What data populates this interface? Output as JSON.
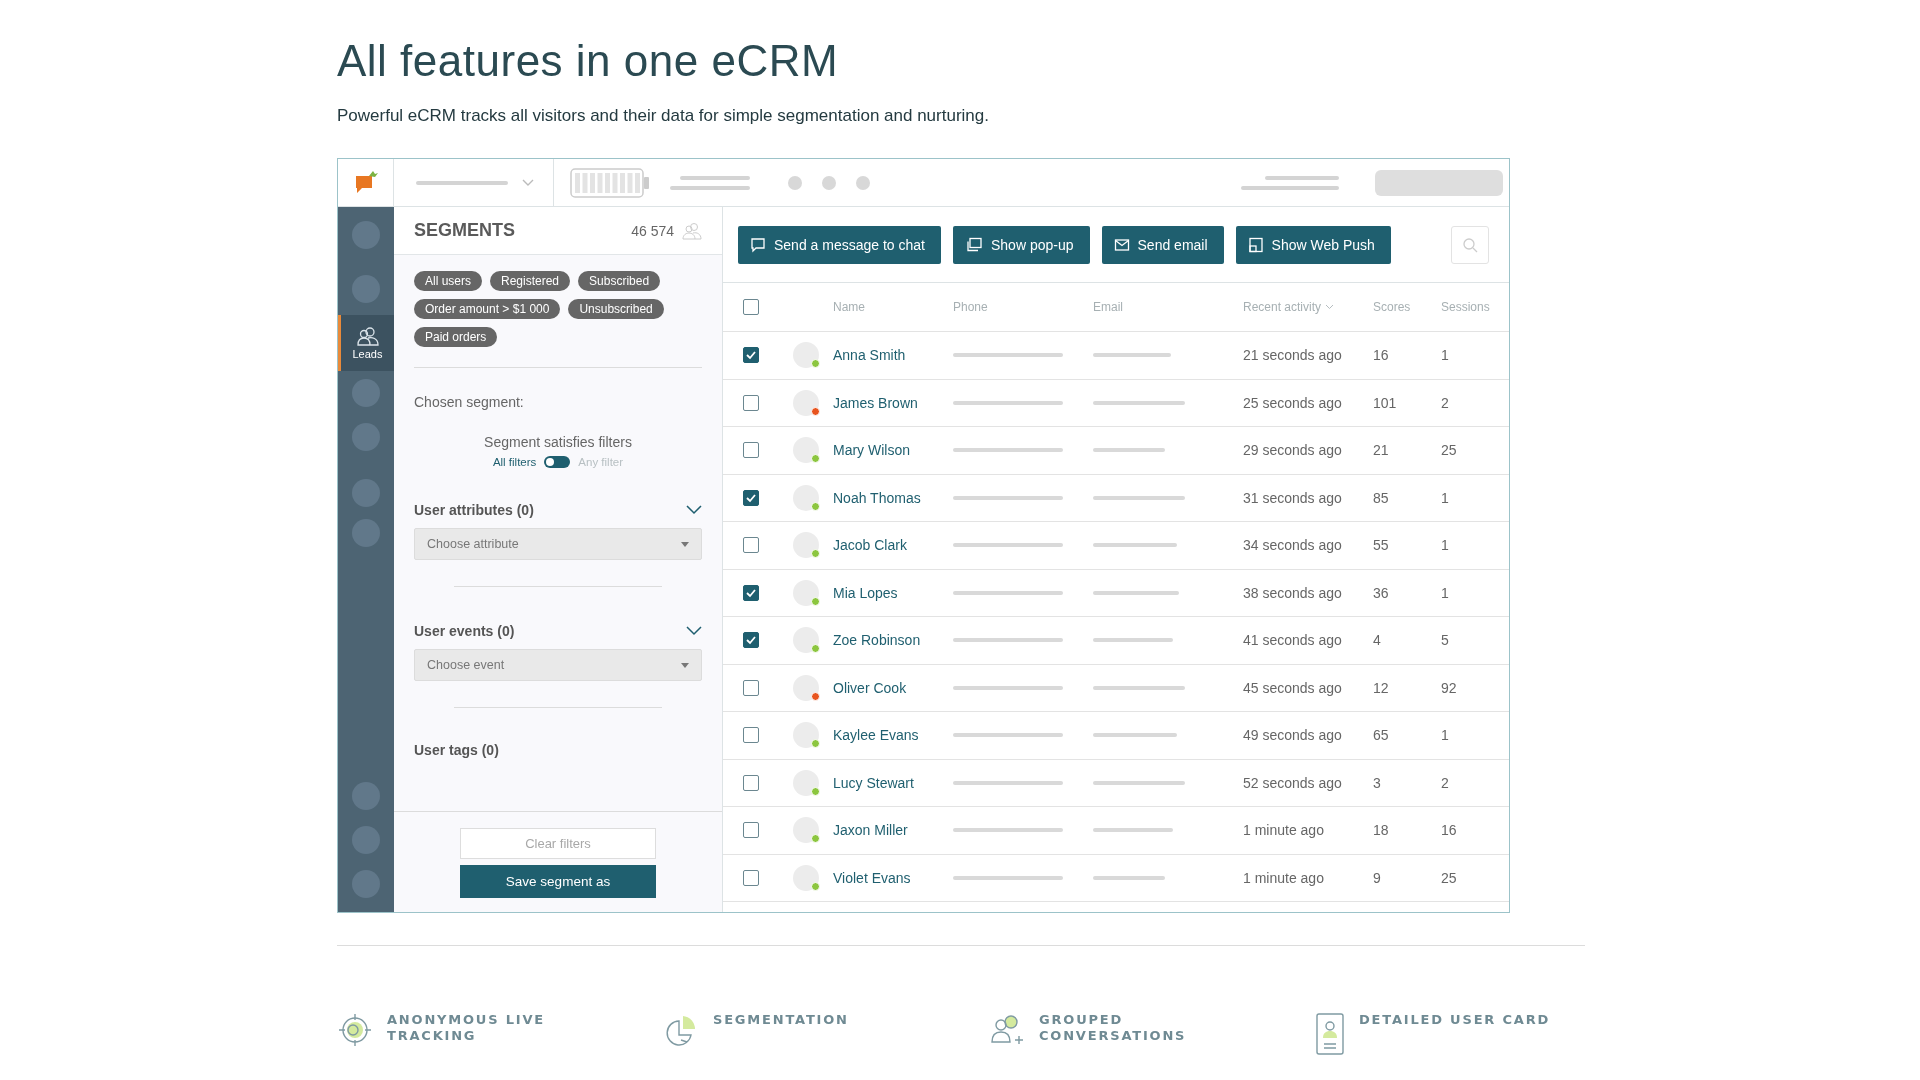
{
  "heading": "All features in one eCRM",
  "subheading": "Powerful eCRM tracks all visitors and their data for simple segmentation and nurturing.",
  "rail": [
    {
      "label": "Leads",
      "selected": true
    }
  ],
  "segments": {
    "title": "SEGMENTS",
    "count": "46 574",
    "chips": [
      "All users",
      "Registered",
      "Subscribed",
      "Order amount > $1 000",
      "Unsubscribed",
      "Paid orders"
    ],
    "chosen_label": "Chosen segment:",
    "filters_title": "Segment satisfies filters",
    "toggle": {
      "left": "All filters",
      "right": "Any filter",
      "on": false
    },
    "sections": [
      {
        "title": "User attributes (0)",
        "placeholder": "Choose attribute"
      },
      {
        "title": "User events (0)",
        "placeholder": "Choose event"
      },
      {
        "title": "User tags (0)"
      }
    ],
    "clear_button": "Clear filters",
    "save_button": "Save segment as"
  },
  "actions": [
    {
      "label": "Send a message to chat",
      "kind": "chat"
    },
    {
      "label": "Show pop-up",
      "kind": "popup"
    },
    {
      "label": "Send email",
      "kind": "mail"
    },
    {
      "label": "Show Web Push",
      "kind": "push"
    }
  ],
  "table": {
    "header_checked": false,
    "columns": [
      "Name",
      "Phone",
      "Email",
      "Recent activity",
      "Scores",
      "Sessions"
    ],
    "rows": [
      {
        "checked": true,
        "name": "Anna Smith",
        "activity": "21 seconds ago",
        "scores": "16",
        "sessions": "1",
        "color": "#8cc63f"
      },
      {
        "checked": false,
        "name": "James Brown",
        "activity": "25 seconds ago",
        "scores": "101",
        "sessions": "2",
        "color": "#e8541e"
      },
      {
        "checked": false,
        "name": "Mary Wilson",
        "activity": "29 seconds ago",
        "scores": "21",
        "sessions": "25",
        "color": "#8cc63f"
      },
      {
        "checked": true,
        "name": "Noah Thomas",
        "activity": "31 seconds ago",
        "scores": "85",
        "sessions": "1",
        "color": "#8cc63f"
      },
      {
        "checked": false,
        "name": "Jacob Clark",
        "activity": "34 seconds ago",
        "scores": "55",
        "sessions": "1",
        "color": "#8cc63f"
      },
      {
        "checked": true,
        "name": "Mia Lopes",
        "activity": "38 seconds ago",
        "scores": "36",
        "sessions": "1",
        "color": "#8cc63f"
      },
      {
        "checked": true,
        "name": "Zoe Robinson",
        "activity": "41 seconds ago",
        "scores": "4",
        "sessions": "5",
        "color": "#8cc63f"
      },
      {
        "checked": false,
        "name": "Oliver Cook",
        "activity": "45 seconds ago",
        "scores": "12",
        "sessions": "92",
        "color": "#e8541e"
      },
      {
        "checked": false,
        "name": "Kaylee Evans",
        "activity": "49 seconds ago",
        "scores": "65",
        "sessions": "1",
        "color": "#8cc63f"
      },
      {
        "checked": false,
        "name": "Lucy Stewart",
        "activity": "52 seconds ago",
        "scores": "3",
        "sessions": "2",
        "color": "#8cc63f"
      },
      {
        "checked": false,
        "name": "Jaxon Miller",
        "activity": "1 minute ago",
        "scores": "18",
        "sessions": "16",
        "color": "#8cc63f"
      },
      {
        "checked": false,
        "name": "Violet Evans",
        "activity": "1 minute ago",
        "scores": "9",
        "sessions": "25",
        "color": "#8cc63f"
      }
    ]
  },
  "features": [
    {
      "kind": "target",
      "label": "ANONYMOUS LIVE TRACKING"
    },
    {
      "kind": "pie",
      "label": "SEGMENTATION"
    },
    {
      "kind": "people",
      "label": "GROUPED CONVERSATIONS"
    },
    {
      "kind": "card",
      "label": "DETAILED USER CARD"
    }
  ]
}
